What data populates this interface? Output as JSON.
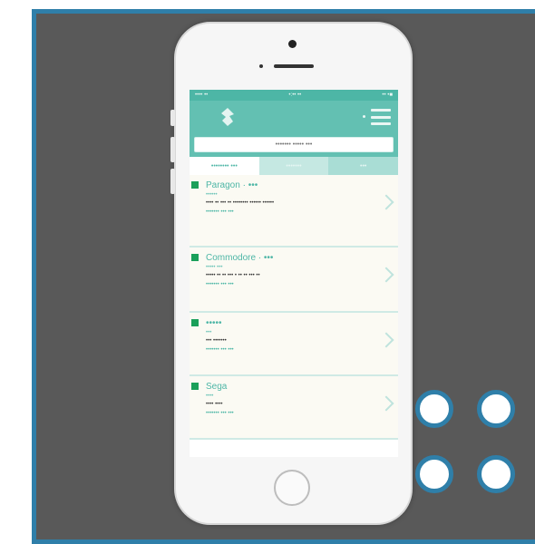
{
  "status_bar": {
    "carrier": "•••• ••",
    "time": "•:•• ••",
    "battery": "•• •■"
  },
  "search": {
    "placeholder": "••••••• ••••• •••"
  },
  "tabs": [
    {
      "label": "•••••••• •••"
    },
    {
      "label": "•••••••"
    },
    {
      "label": "•••"
    }
  ],
  "list": [
    {
      "title": "Paragon · •••",
      "subtitle": "••••••",
      "description": "•••• •• ••• •• •••••••• •••••• ••••••",
      "meta": "••••••• ••• •••"
    },
    {
      "title": "Commodore · •••",
      "subtitle": "••••• •••",
      "description": "••••• •• •• ••• • •• •• ••• ••",
      "meta": "••••••• ••• •••"
    },
    {
      "title": "•••••",
      "subtitle": "•••",
      "description": "••• •••••••",
      "meta": "••••••• ••• •••"
    },
    {
      "title": "Sega",
      "subtitle": "••••",
      "description": "•••• ••••",
      "meta": "••••••• ••• •••"
    }
  ],
  "colors": {
    "frame_border": "#2f7fa9",
    "frame_bg": "#595959",
    "app_teal": "#63c0b2",
    "accent_green": "#1aa05a"
  },
  "icons": [
    "logo-icon",
    "menu-icon",
    "chevron-right-icon",
    "home-button-icon"
  ]
}
